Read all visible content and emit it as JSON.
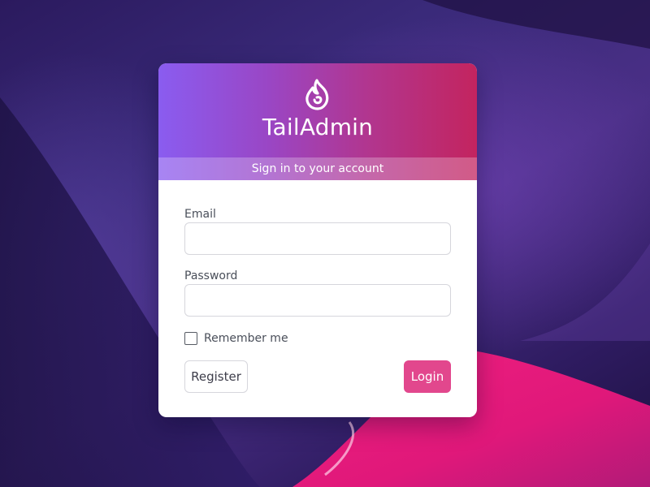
{
  "brand": {
    "name": "TailAdmin",
    "logo_icon": "flame-icon",
    "subtitle": "Sign in to your account"
  },
  "form": {
    "email": {
      "label": "Email",
      "value": "",
      "placeholder": ""
    },
    "password": {
      "label": "Password",
      "value": "",
      "placeholder": ""
    },
    "remember": {
      "label": "Remember me",
      "checked": false
    }
  },
  "actions": {
    "register_label": "Register",
    "login_label": "Login"
  },
  "colors": {
    "header_gradient_start": "#8a5cf0",
    "header_gradient_end": "#c3245f",
    "login_button": "#e2478d",
    "background": "#2a1a5c",
    "background_accent": "#f0207f"
  }
}
